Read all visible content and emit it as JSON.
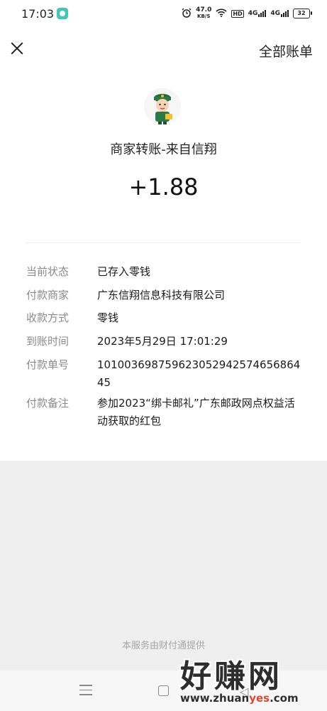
{
  "status_bar": {
    "time": "17:03",
    "net_speed_value": "47.0",
    "net_speed_unit": "KB/S",
    "hd": "HD",
    "sig1": "4G",
    "sig2": "4G",
    "battery": "32"
  },
  "header": {
    "right_link": "全部账单"
  },
  "transfer": {
    "title": "商家转账-来自信翔",
    "amount": "+1.88"
  },
  "details": [
    {
      "label": "当前状态",
      "value": "已存入零钱"
    },
    {
      "label": "付款商家",
      "value": "广东信翔信息科技有限公司"
    },
    {
      "label": "收款方式",
      "value": "零钱"
    },
    {
      "label": "到账时间",
      "value": "2023年5月29日 17:01:29"
    },
    {
      "label": "付款单号",
      "value": "10100369875962305294257465686445"
    },
    {
      "label": "付款备注",
      "value": "参加2023“绑卡邮礼”广东邮政网点权益活动获取的红包"
    }
  ],
  "footer": {
    "provider": "本服务由财付通提供"
  },
  "watermark": {
    "big": "好赚网",
    "url_pre": "www.zhuan",
    "url_hl": "yes",
    "url_post": ".com"
  },
  "colors": {
    "accent_wechat_app": "#3cc8b4",
    "watermark_highlight": "#e0472b"
  }
}
